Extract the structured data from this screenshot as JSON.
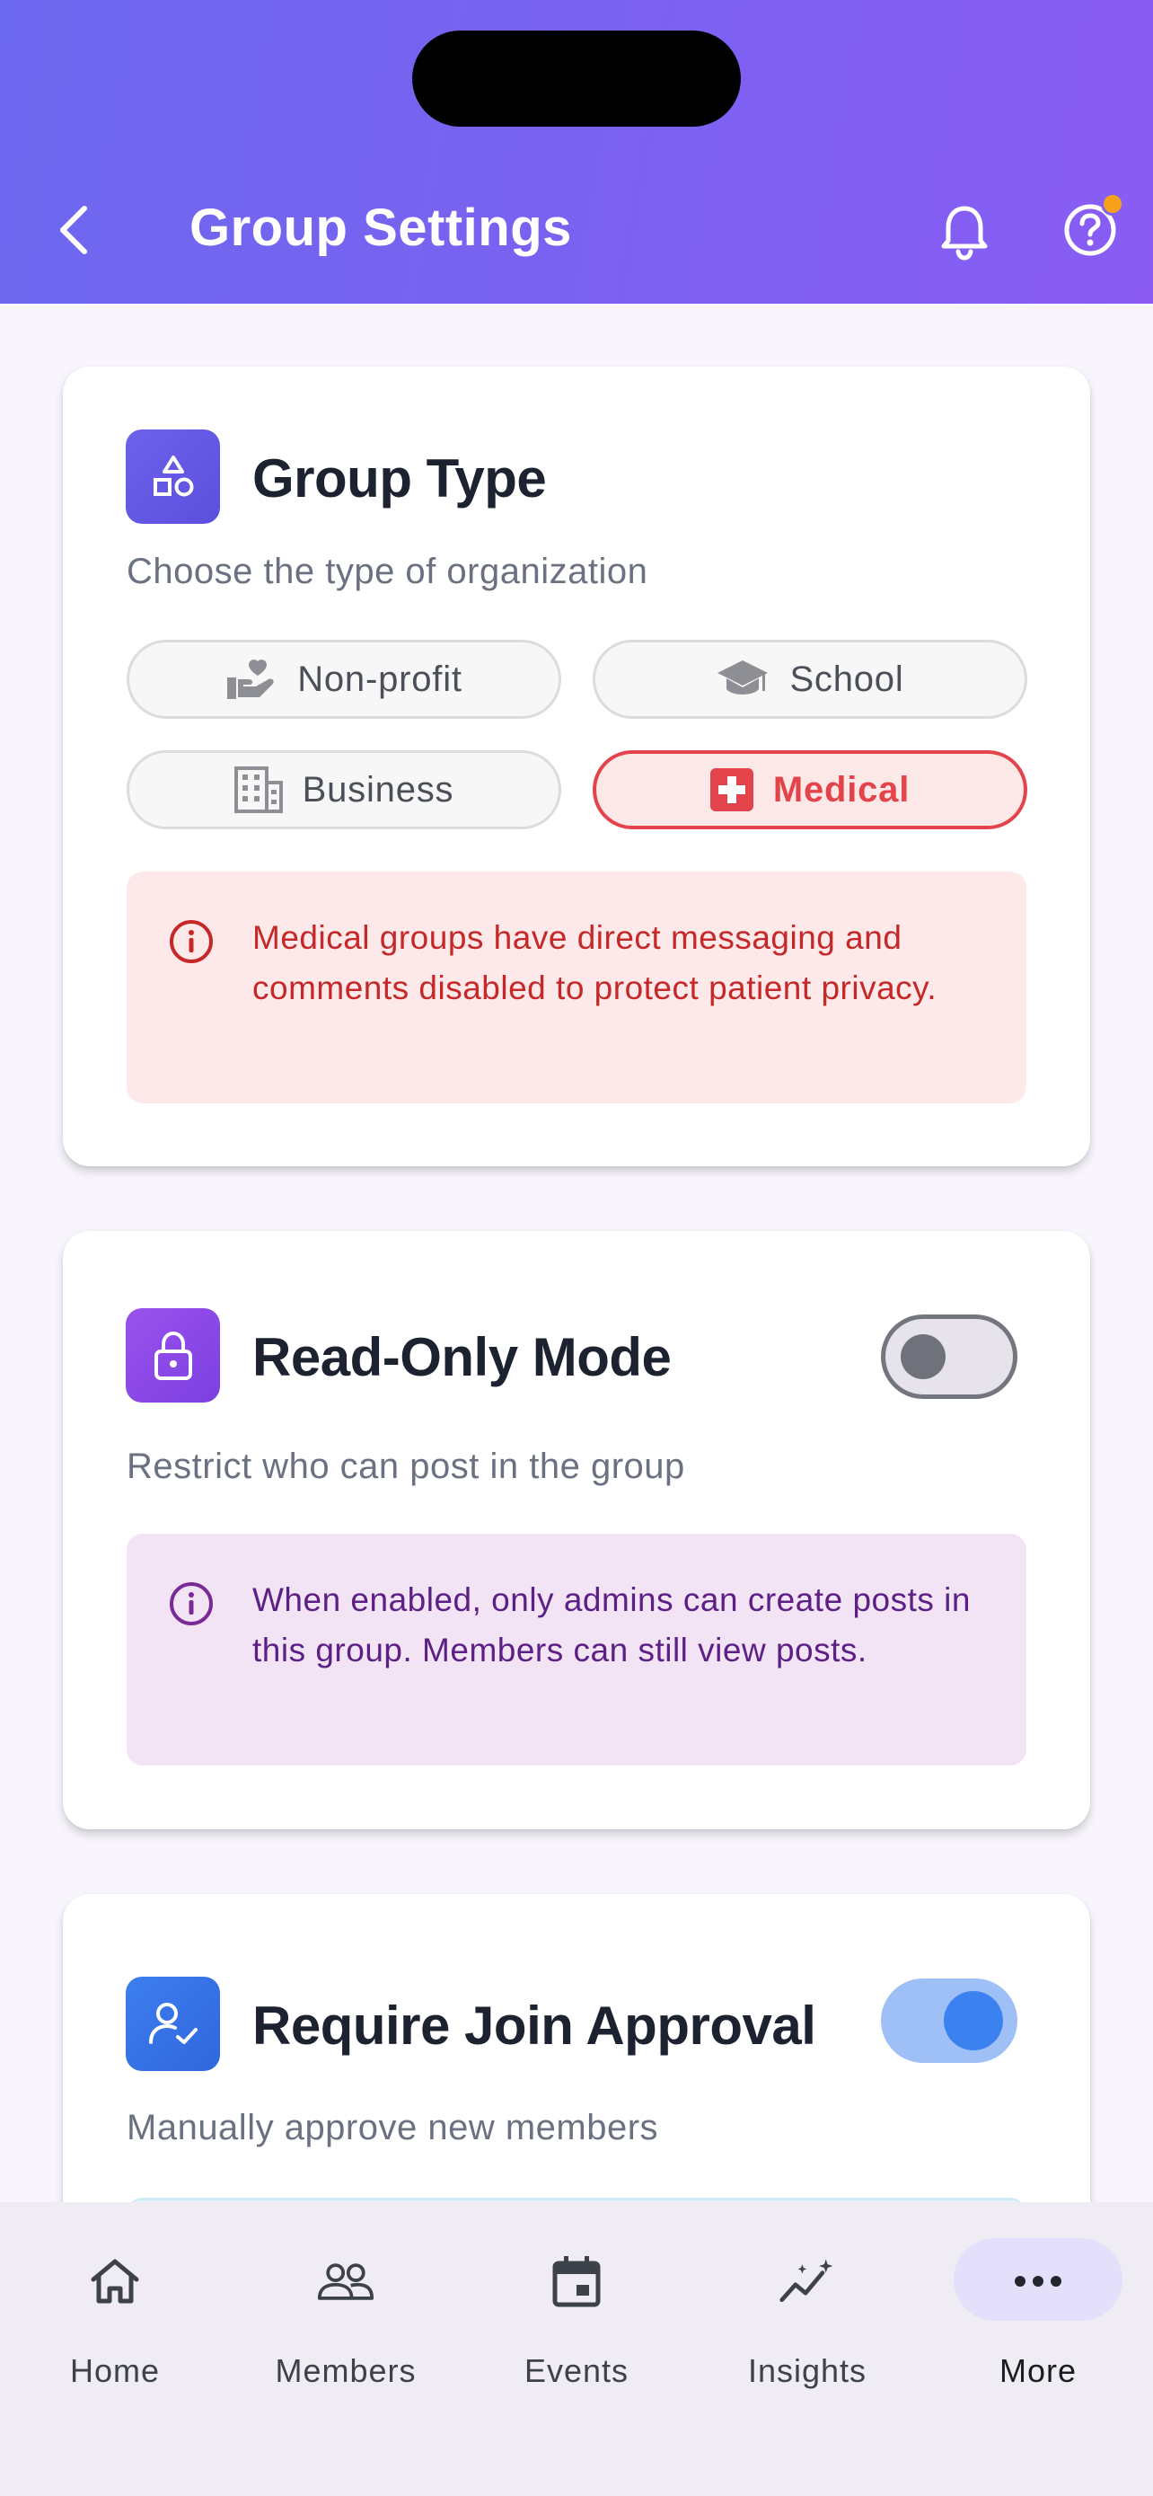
{
  "header": {
    "title": "Group Settings",
    "back_icon": "chevron-left-icon",
    "bell_icon": "bell-icon",
    "help_icon": "help-circle-icon",
    "gradient_start": "#6c68ef",
    "gradient_end": "#8a5cf4"
  },
  "group_type": {
    "title": "Group Type",
    "subtitle": "Choose the type of organization",
    "icon": "shapes-icon",
    "options": [
      {
        "label": "Non-profit",
        "icon": "hand-heart-icon",
        "selected": false
      },
      {
        "label": "School",
        "icon": "graduation-cap-icon",
        "selected": false
      },
      {
        "label": "Business",
        "icon": "building-icon",
        "selected": false
      },
      {
        "label": "Medical",
        "icon": "medical-cross-icon",
        "selected": true
      }
    ],
    "notice": "Medical groups have direct messaging and comments disabled to protect patient privacy.",
    "notice_color": "#c62828"
  },
  "read_only": {
    "title": "Read-Only Mode",
    "subtitle": "Restrict who can post in the group",
    "icon": "lock-icon",
    "enabled": false,
    "notice": "When enabled, only admins can create posts in this group. Members can still view posts.",
    "notice_color": "#5b1f86"
  },
  "join_approval": {
    "title": "Require Join Approval",
    "subtitle": "Manually approve new members",
    "icon": "user-check-icon",
    "enabled": true
  },
  "tabbar": {
    "tabs": [
      {
        "label": "Home",
        "icon": "home-icon"
      },
      {
        "label": "Members",
        "icon": "users-icon"
      },
      {
        "label": "Events",
        "icon": "calendar-icon"
      },
      {
        "label": "Insights",
        "icon": "sparkle-chart-icon"
      },
      {
        "label": "More",
        "icon": "more-dots-icon",
        "active": true
      }
    ]
  }
}
